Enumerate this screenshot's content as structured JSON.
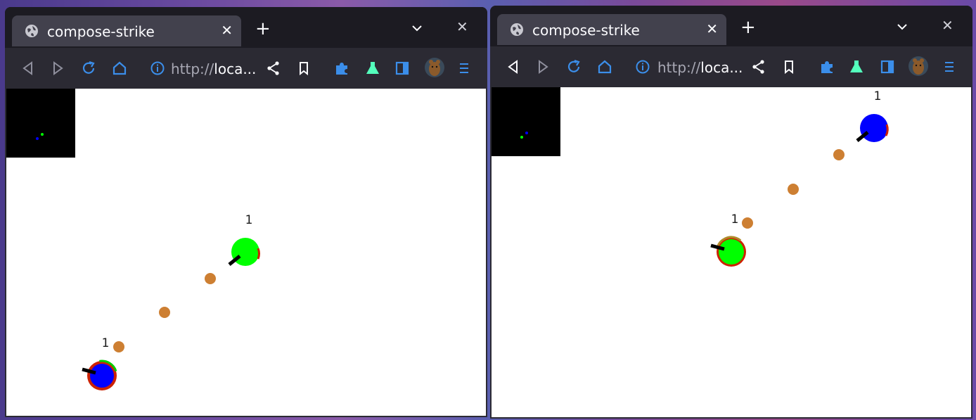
{
  "windows": [
    {
      "tab_title": "compose-strike",
      "url_prefix": "http://",
      "url_host": "loca...",
      "players": [
        {
          "label": "1",
          "color": "#00ff00"
        },
        {
          "label": "1",
          "color": "#0000ff"
        }
      ]
    },
    {
      "tab_title": "compose-strike",
      "url_prefix": "http://",
      "url_host": "loca...",
      "players": [
        {
          "label": "1",
          "color": "#0000ff"
        },
        {
          "label": "1",
          "color": "#00ff00"
        }
      ]
    }
  ],
  "colors": {
    "bullet": "#cd7f32",
    "health_arc": "#cc2200",
    "minimap_bg": "#000000",
    "accent_blue": "#3b8eea",
    "accent_green": "#54ffbd"
  },
  "icons": [
    "globe-icon",
    "close-icon",
    "plus-icon",
    "chevron-down-icon",
    "back-icon",
    "forward-icon",
    "reload-icon",
    "home-icon",
    "info-icon",
    "share-icon",
    "bookmark-icon",
    "extensions-icon",
    "flask-icon",
    "sidebar-icon",
    "avatar",
    "menu-icon"
  ]
}
